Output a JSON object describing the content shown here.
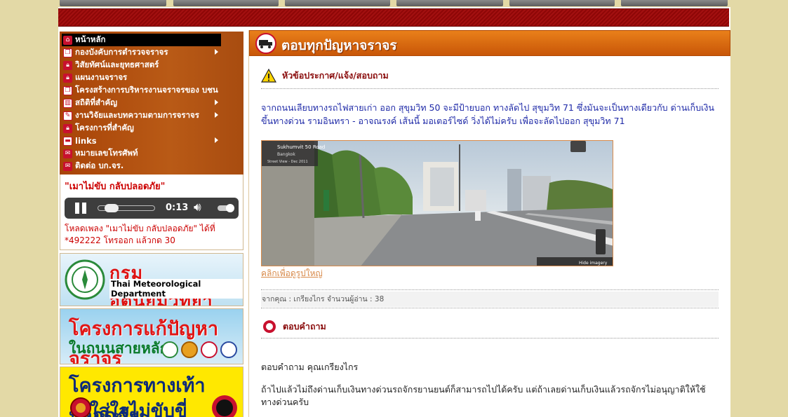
{
  "sidebar": {
    "menu": [
      {
        "label": "หน้าหลัก",
        "icon": "home-icon",
        "arrow": false,
        "active": true
      },
      {
        "label": "กองบังคับการตำรวจจราจร",
        "icon": "pages-icon",
        "arrow": true,
        "active": false
      },
      {
        "label": "วิสัยทัศน์และยุทธศาสตร์",
        "icon": "lock-icon",
        "arrow": false,
        "active": false
      },
      {
        "label": "แผนงานจราจร",
        "icon": "lock-icon",
        "arrow": false,
        "active": false
      },
      {
        "label": "โครงสร้างการบริหารงานจราจรของ บชน",
        "icon": "pages-icon",
        "arrow": false,
        "active": false
      },
      {
        "label": "สถิติที่สำคัญ",
        "icon": "chart-icon",
        "arrow": true,
        "active": false
      },
      {
        "label": "งานวิจัยและบทความตามการจราจร",
        "icon": "pencil-icon",
        "arrow": true,
        "active": false
      },
      {
        "label": "โครงการที่สำคัญ",
        "icon": "lock-icon",
        "arrow": false,
        "active": false
      },
      {
        "label": "links",
        "icon": "folder-icon",
        "arrow": true,
        "active": false
      },
      {
        "label": "หมายเลขโทรศัพท์",
        "icon": "chat-icon",
        "arrow": false,
        "active": false
      },
      {
        "label": "ติดต่อ บก.จร.",
        "icon": "chat-icon",
        "arrow": false,
        "active": false
      }
    ],
    "song": {
      "title": "\"เมาไม่ขับ กลับปลอดภัย\"",
      "time": "0:13",
      "progress_fraction": 0.14,
      "volume_fraction": 1.0,
      "download_text": "โหลดเพลง \"เมาไม่ขับ กลับปลอดภัย\" ได้ที่ *492222 โทรออก แล้วกด 30"
    },
    "promos": {
      "tmd_th": "กรมอุตุนิยมวิทยา",
      "tmd_en": "Thai Meteorological Department",
      "traffic_line1": "โครงการแก้ปัญหาจราจร",
      "traffic_line2": "ในถนนสายหลัก",
      "walk_line1": "โครงการทางเท้าปลอดภัย",
      "walk_line2": "ใส่ใจไม่ขับขี่"
    }
  },
  "main": {
    "header_title": "ตอบทุกปัญหาจราจร",
    "topic_label": "หัวข้อประกาศ/แจ้ง/สอบถาม",
    "question": "จากถนนเลียบทางรถไฟสายเก่า ออก สุขุมวิท 50 จะมีป้ายบอก ทางลัดไป สุขุมวิท 71 ซึ่งมันจะเป็นทางเดียวกับ ด่านเก็บเงินขึ้นทางด่วน รามอินทรา - อาจณรงค์ เส้นนี้ มอเตอร์ไซด์ วิ่งได้ไม่ครับ เพื่อจะลัดไปออก สุขุมวิท 71",
    "photo_street": "Sukhumvit 50 Road",
    "photo_city": "Bangkok",
    "photo_sv": "Street View - Dec 2011",
    "photo_hide": "Hide imagery",
    "photo_link": "คลิกเพื่อดูรูปใหญ่",
    "meta": "จากคุณ : เกรียงไกร    จำนวนผู้อ่าน : 38",
    "answer_label": "ตอบคำถาม",
    "answer_heading": "ตอบคำถาม คุณเกรียงไกร",
    "answer_text": "ถ้าไปแล้วไม่ถึงด่านเก็บเงินทางด่วนรถจักรยานยนต์ก็สามารถไปได้ครับ แต่ถ้าเลยด่านเก็บเงินแล้วรถจักรไม่อนุญาติให้ใช้ทางด่วนครับ"
  },
  "colors": {
    "banner": "#8e0707",
    "menu_bg": "#b15010",
    "header_orange": "#e07018",
    "question_blue": "#1f2aa8",
    "accent_red": "#c8102e",
    "page_bg": "#e3d9a6"
  }
}
